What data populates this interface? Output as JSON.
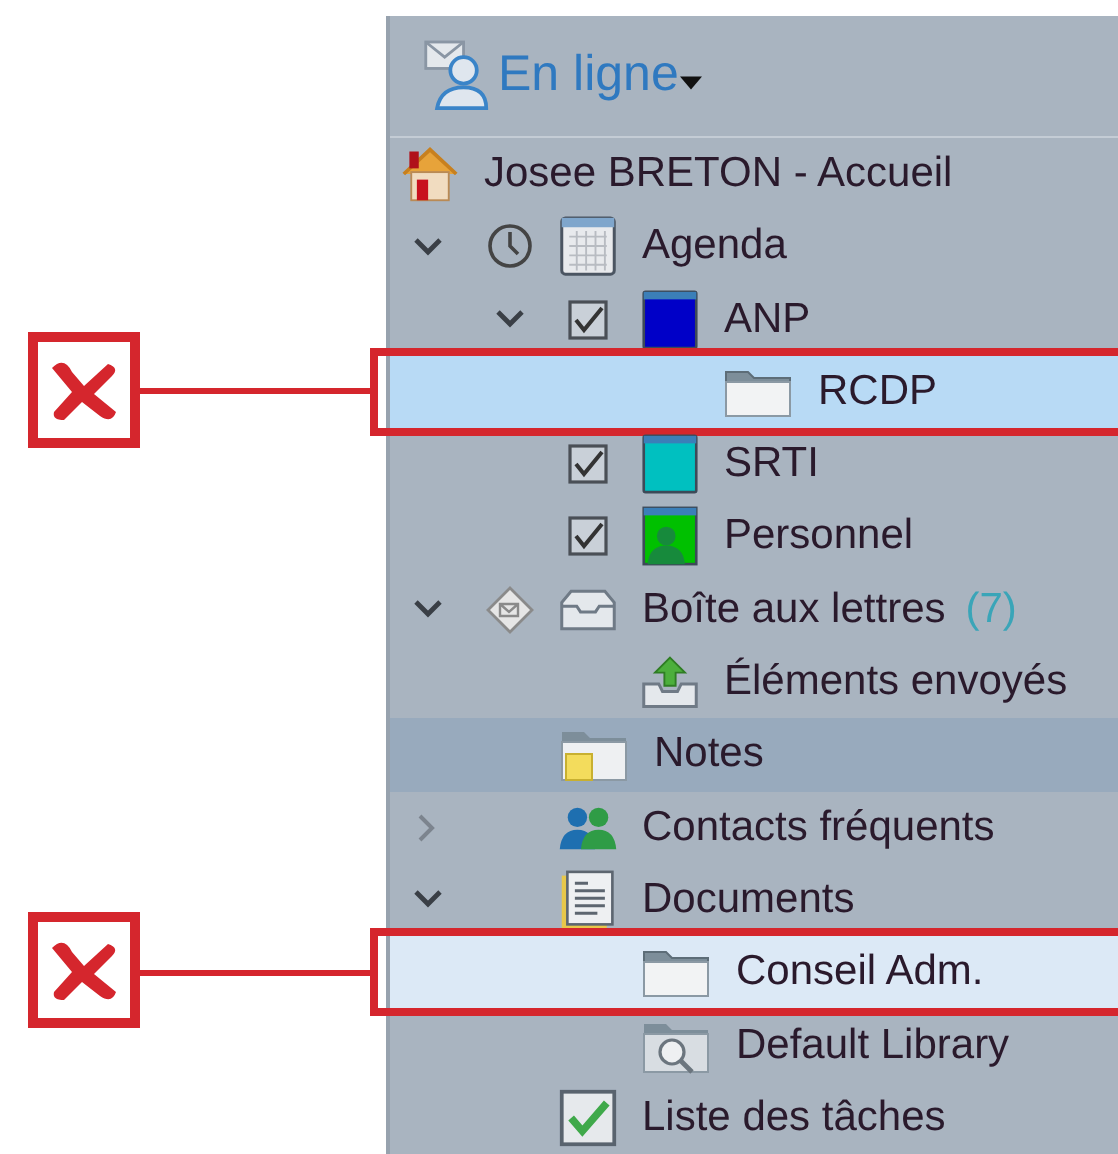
{
  "header": {
    "status": "En ligne"
  },
  "tree": [
    {
      "label": "Josee BRETON - Accueil",
      "kind": "home",
      "selected": false,
      "children": [
        {
          "label": "Agenda",
          "kind": "calendar",
          "expanded": true,
          "selected": false,
          "children": [
            {
              "label": "ANP",
              "kind": "color",
              "color": "#0000c8",
              "checked": true,
              "expanded": true,
              "selected": false,
              "children": [
                {
                  "label": "RCDP",
                  "kind": "folder",
                  "selected": true,
                  "focused": true,
                  "flagged": true
                }
              ]
            },
            {
              "label": "SRTI",
              "kind": "color",
              "color": "#00c0c0",
              "checked": true,
              "selected": false
            },
            {
              "label": "Personnel",
              "kind": "person",
              "color": "#00c000",
              "checked": true,
              "selected": false
            }
          ]
        },
        {
          "label": "Boîte aux lettres",
          "count": "(7)",
          "kind": "inbox",
          "expanded": true,
          "selected": false,
          "children": [
            {
              "label": "Éléments envoyés",
              "kind": "outbox",
              "selected": false
            }
          ]
        },
        {
          "label": "Notes",
          "kind": "notes",
          "selected": false,
          "hover": true
        },
        {
          "label": "Contacts fréquents",
          "kind": "contacts",
          "expanded": false,
          "selected": false
        },
        {
          "label": "Documents",
          "kind": "documents",
          "expanded": true,
          "selected": false,
          "children": [
            {
              "label": "Conseil Adm.",
              "kind": "folder",
              "selected": true,
              "focused": false,
              "flagged": true
            },
            {
              "label": "Default Library",
              "kind": "library",
              "selected": false
            }
          ]
        },
        {
          "label": "Liste des tâches",
          "kind": "tasks",
          "selected": false
        }
      ]
    }
  ]
}
